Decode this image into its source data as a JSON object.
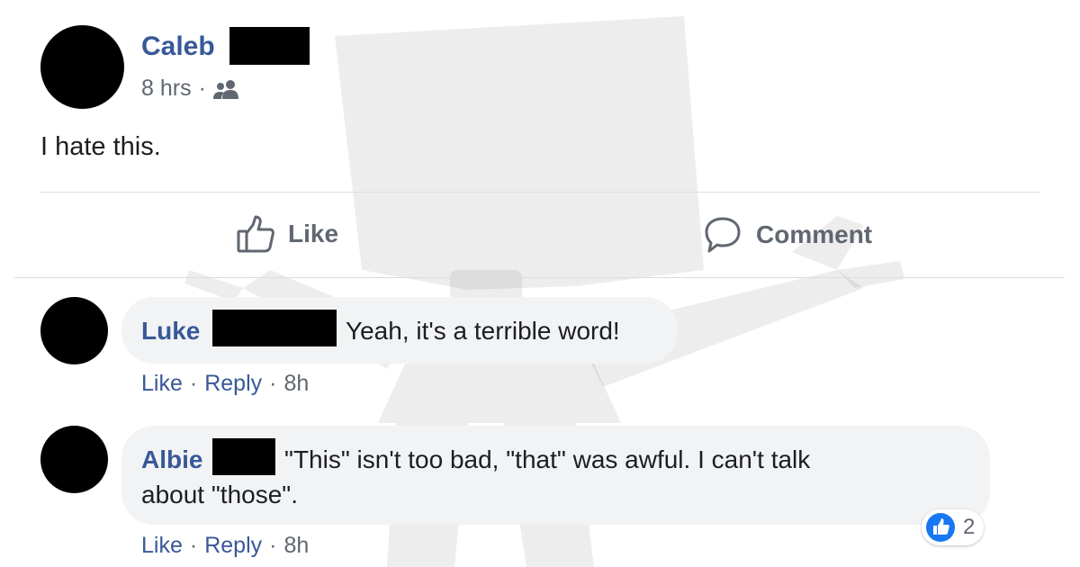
{
  "post": {
    "author": "Caleb",
    "time": "8 hrs",
    "separator": "·",
    "audience_icon": "friends-icon",
    "text": "I hate this."
  },
  "actions": {
    "like_label": "Like",
    "comment_label": "Comment"
  },
  "comments": [
    {
      "author": "Luke",
      "text": "Yeah, it's a terrible word!",
      "like": "Like",
      "reply": "Reply",
      "time": "8h"
    },
    {
      "author": "Albie",
      "text_line1": "\"This\" isn't too bad, \"that\" was awful. I can't talk",
      "text_line2": "about \"those\".",
      "like": "Like",
      "reply": "Reply",
      "time": "8h",
      "reaction_count": "2",
      "reaction_icon": "like-reaction-icon"
    }
  ],
  "colors": {
    "link": "#385898",
    "meta": "#606770",
    "bubble": "#f2f3f5",
    "like_blue": "#1877f2"
  }
}
